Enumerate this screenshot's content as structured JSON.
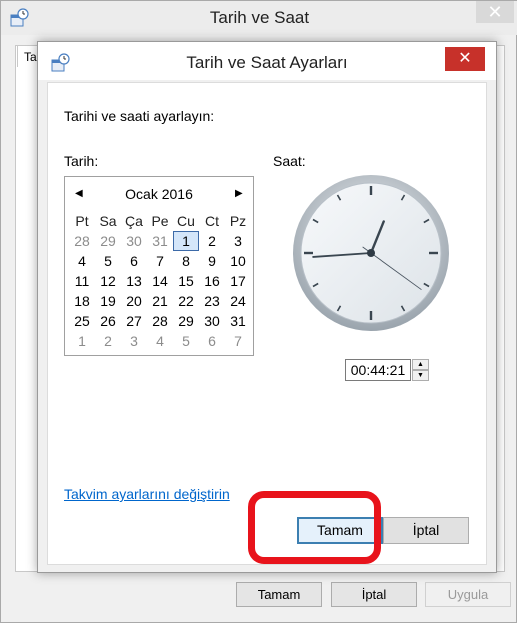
{
  "outer_window": {
    "title": "Tarih ve Saat",
    "close_label": "✕",
    "tab_label": "Ta",
    "buttons": {
      "ok": "Tamam",
      "cancel": "İptal",
      "apply": "Uygula"
    }
  },
  "dialog": {
    "title": "Tarih ve Saat Ayarları",
    "close_label": "✕",
    "instruction": "Tarihi ve saati ayarlayın:",
    "date_label": "Tarih:",
    "time_label": "Saat:",
    "calendar": {
      "month_label": "Ocak 2016",
      "prev_icon": "◀",
      "next_icon": "▶",
      "weekday_headers": [
        "Pt",
        "Sa",
        "Ça",
        "Pe",
        "Cu",
        "Ct",
        "Pz"
      ],
      "days": [
        {
          "d": "28",
          "muted": true
        },
        {
          "d": "29",
          "muted": true
        },
        {
          "d": "30",
          "muted": true
        },
        {
          "d": "31",
          "muted": true
        },
        {
          "d": "1",
          "selected": true
        },
        {
          "d": "2"
        },
        {
          "d": "3"
        },
        {
          "d": "4"
        },
        {
          "d": "5"
        },
        {
          "d": "6"
        },
        {
          "d": "7"
        },
        {
          "d": "8"
        },
        {
          "d": "9"
        },
        {
          "d": "10"
        },
        {
          "d": "11"
        },
        {
          "d": "12"
        },
        {
          "d": "13"
        },
        {
          "d": "14"
        },
        {
          "d": "15"
        },
        {
          "d": "16"
        },
        {
          "d": "17"
        },
        {
          "d": "18"
        },
        {
          "d": "19"
        },
        {
          "d": "20"
        },
        {
          "d": "21"
        },
        {
          "d": "22"
        },
        {
          "d": "23"
        },
        {
          "d": "24"
        },
        {
          "d": "25"
        },
        {
          "d": "26"
        },
        {
          "d": "27"
        },
        {
          "d": "28"
        },
        {
          "d": "29"
        },
        {
          "d": "30"
        },
        {
          "d": "31"
        },
        {
          "d": "1",
          "muted": true
        },
        {
          "d": "2",
          "muted": true
        },
        {
          "d": "3",
          "muted": true
        },
        {
          "d": "4",
          "muted": true
        },
        {
          "d": "5",
          "muted": true
        },
        {
          "d": "6",
          "muted": true
        },
        {
          "d": "7",
          "muted": true
        }
      ]
    },
    "clock": {
      "hours": 0,
      "minutes": 44,
      "seconds": 21
    },
    "time_value": "00:44:21",
    "spin_up_icon": "▲",
    "spin_down_icon": "▼",
    "calendar_settings_link": "Takvim ayarlarını değiştirin",
    "ok_button": "Tamam",
    "cancel_button": "İptal"
  },
  "colors": {
    "close_red": "#c7312a",
    "link_blue": "#0066cc",
    "annotation_red": "#e8131b",
    "default_button_border": "#3c7fb1"
  }
}
